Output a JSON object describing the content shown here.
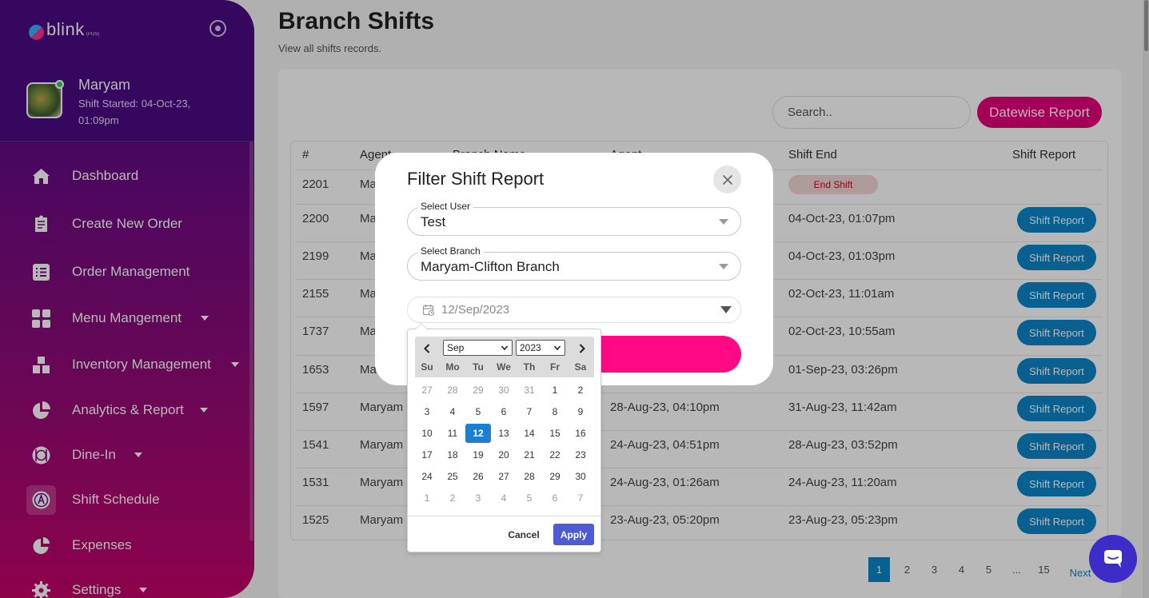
{
  "sidebar": {
    "logo_text": "blink",
    "logo_sub": "(POS)",
    "user": {
      "name": "Maryam",
      "shift_started": "Shift Started: 04-Oct-23, 01:09pm"
    },
    "items": [
      {
        "label": "Dashboard",
        "icon": "home-icon",
        "has_caret": false
      },
      {
        "label": "Create New Order",
        "icon": "receipt-icon",
        "has_caret": false
      },
      {
        "label": "Order Management",
        "icon": "list-icon",
        "has_caret": false
      },
      {
        "label": "Menu Mangement",
        "icon": "grid-icon",
        "has_caret": true
      },
      {
        "label": "Inventory Management",
        "icon": "boxes-icon",
        "has_caret": true
      },
      {
        "label": "Analytics & Report",
        "icon": "pie-chart-icon",
        "has_caret": true
      },
      {
        "label": "Dine-In",
        "icon": "dining-icon",
        "has_caret": true
      },
      {
        "label": "Shift Schedule",
        "icon": "schedule-icon",
        "has_caret": false
      },
      {
        "label": "Expenses",
        "icon": "expenses-icon",
        "has_caret": false
      },
      {
        "label": "Settings",
        "icon": "gear-icon",
        "has_caret": true
      }
    ]
  },
  "page": {
    "title": "Branch Shifts",
    "subtitle": "View all shifts records.",
    "search_placeholder": "Search..",
    "datewise_button": "Datewise Report"
  },
  "table": {
    "headers": [
      "#",
      "Agent",
      "Branch Name",
      "Agent",
      "Shift End",
      "Shift Report"
    ],
    "rows": [
      {
        "id": "2201",
        "agent": "Ma",
        "start": "",
        "end": "",
        "end_shift": "End Shift",
        "report": ""
      },
      {
        "id": "2200",
        "agent": "Ma",
        "start": "",
        "end": "04-Oct-23, 01:07pm",
        "end_shift": "",
        "report": "Shift Report"
      },
      {
        "id": "2199",
        "agent": "Ma",
        "start": "",
        "end": "04-Oct-23, 01:03pm",
        "end_shift": "",
        "report": "Shift Report"
      },
      {
        "id": "2155",
        "agent": "Ma",
        "start": "",
        "end": "02-Oct-23, 11:01am",
        "end_shift": "",
        "report": "Shift Report"
      },
      {
        "id": "1737",
        "agent": "Ma",
        "start": "",
        "end": "02-Oct-23, 10:55am",
        "end_shift": "",
        "report": "Shift Report"
      },
      {
        "id": "1653",
        "agent": "Ma",
        "start": "",
        "end": "01-Sep-23, 03:26pm",
        "end_shift": "",
        "report": "Shift Report"
      },
      {
        "id": "1597",
        "agent": "Maryam",
        "start": "28-Aug-23, 04:10pm",
        "end": "31-Aug-23, 11:42am",
        "end_shift": "",
        "report": "Shift Report"
      },
      {
        "id": "1541",
        "agent": "Maryam",
        "start": "24-Aug-23, 04:51pm",
        "end": "28-Aug-23, 03:52pm",
        "end_shift": "",
        "report": "Shift Report"
      },
      {
        "id": "1531",
        "agent": "Maryam",
        "start": "24-Aug-23, 01:26am",
        "end": "24-Aug-23, 11:20am",
        "end_shift": "",
        "report": "Shift Report"
      },
      {
        "id": "1525",
        "agent": "Maryam",
        "start": "23-Aug-23, 05:20pm",
        "end": "23-Aug-23, 05:23pm",
        "end_shift": "",
        "report": "Shift Report"
      }
    ]
  },
  "pagination": {
    "pages": [
      "1",
      "2",
      "3",
      "4",
      "5",
      "...",
      "15"
    ],
    "active": "1",
    "next": "Next"
  },
  "modal": {
    "title": "Filter Shift Report",
    "user_label": "Select User",
    "user_value": "Test",
    "branch_label": "Select Branch",
    "branch_value": "Maryam-Clifton Branch",
    "date_value": "12/Sep/2023"
  },
  "datepicker": {
    "month": "Sep",
    "year": "2023",
    "weekdays": [
      "Su",
      "Mo",
      "Tu",
      "We",
      "Th",
      "Fr",
      "Sa"
    ],
    "weeks": [
      [
        "27",
        "28",
        "29",
        "30",
        "31",
        "1",
        "2"
      ],
      [
        "3",
        "4",
        "5",
        "6",
        "7",
        "8",
        "9"
      ],
      [
        "10",
        "11",
        "12",
        "13",
        "14",
        "15",
        "16"
      ],
      [
        "17",
        "18",
        "19",
        "20",
        "21",
        "22",
        "23"
      ],
      [
        "24",
        "25",
        "26",
        "27",
        "28",
        "29",
        "30"
      ],
      [
        "1",
        "2",
        "3",
        "4",
        "5",
        "6",
        "7"
      ]
    ],
    "selected": "12",
    "cancel": "Cancel",
    "apply": "Apply"
  },
  "colors": {
    "accent_pink": "#e3007a",
    "button_blue": "#0c85c8",
    "selected_day": "#1c7fd1",
    "apply_button": "#4f5bd5",
    "chat_widget": "#3d2cc7"
  }
}
